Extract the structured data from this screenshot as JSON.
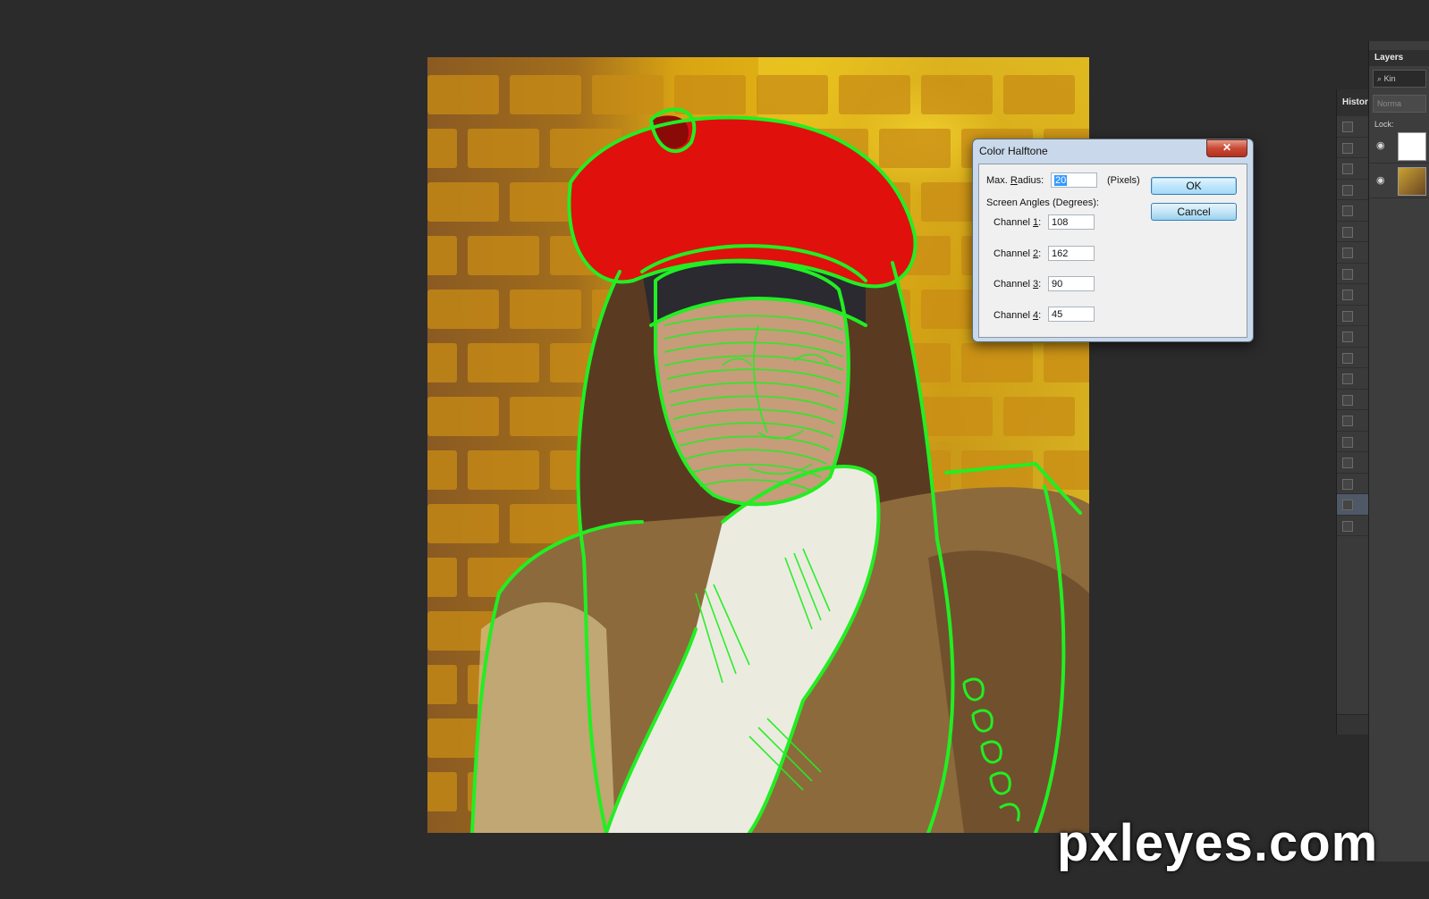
{
  "dialog": {
    "title": "Color Halftone",
    "close_glyph": "✕",
    "max_radius_label_pre": "Max. ",
    "max_radius_label_u": "R",
    "max_radius_label_post": "adius:",
    "max_radius_value": "20",
    "max_radius_unit": "(Pixels)",
    "screen_angles_label": "Screen Angles (Degrees):",
    "channels": [
      {
        "pre": "Channel ",
        "u": "1",
        "post": ":",
        "value": "108"
      },
      {
        "pre": "Channel ",
        "u": "2",
        "post": ":",
        "value": "162"
      },
      {
        "pre": "Channel ",
        "u": "3",
        "post": ":",
        "value": "90"
      },
      {
        "pre": "Channel ",
        "u": "4",
        "post": ":",
        "value": "45"
      }
    ],
    "ok_label": "OK",
    "cancel_label": "Cancel"
  },
  "history_panel": {
    "title": "Histor",
    "row_count": 20,
    "active_row_index": 18
  },
  "layers_panel": {
    "title": "Layers",
    "kind_text": "Kin",
    "blend_text": "Norma",
    "lock_text": "Lock:"
  },
  "watermark": "pxleyes.com",
  "colors": {
    "background": "#2b2b2b",
    "outline_green": "#22ee22",
    "hat_red": "#e0100c",
    "accent_selection": "#3399ff"
  },
  "icons": [
    "search-icon",
    "eye-icon",
    "brush-icon",
    "close-icon"
  ]
}
